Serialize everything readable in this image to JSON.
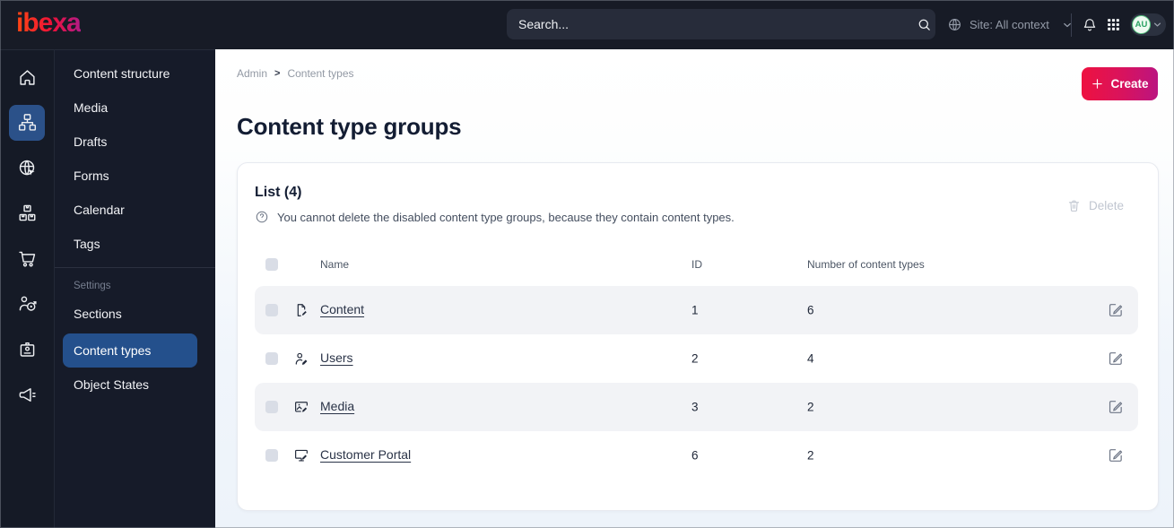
{
  "topbar": {
    "logo_text": "ibexa",
    "search_placeholder": "Search...",
    "site_context_label": "Site: All context",
    "avatar_initials": "AU",
    "icons": [
      "search-icon",
      "globe-icon",
      "chevron-down-icon",
      "bell-icon",
      "app-grid-icon"
    ]
  },
  "rail": {
    "icons": [
      "home-icon",
      "content-structure-icon",
      "site-search-icon",
      "product-catalog-icon",
      "commerce-cart-icon",
      "personalization-icon",
      "admin-badge-icon",
      "campaign-megaphone-icon"
    ],
    "active_index": 1
  },
  "sidebar": {
    "items": [
      "Content structure",
      "Media",
      "Drafts",
      "Forms",
      "Calendar",
      "Tags"
    ],
    "settings_label": "Settings",
    "settings_items": [
      "Sections",
      "Content types",
      "Object States"
    ],
    "active_item": "Content types"
  },
  "main": {
    "breadcrumb": [
      "Admin",
      "Content types"
    ],
    "breadcrumb_separator": ">",
    "create_label": "Create",
    "title": "Content type groups",
    "card": {
      "list_title": "List (4)",
      "info_text": "You cannot delete the disabled content type groups, because they contain content types.",
      "delete_label": "Delete",
      "table": {
        "headers": {
          "name": "Name",
          "id": "ID",
          "count": "Number of content types"
        },
        "rows": [
          {
            "name": "Content",
            "id": "1",
            "count": "6",
            "icon": "file-edit-icon"
          },
          {
            "name": "Users",
            "id": "2",
            "count": "4",
            "icon": "user-edit-icon"
          },
          {
            "name": "Media",
            "id": "3",
            "count": "2",
            "icon": "image-edit-icon"
          },
          {
            "name": "Customer Portal",
            "id": "6",
            "count": "2",
            "icon": "monitor-edit-icon"
          }
        ]
      }
    }
  },
  "colors": {
    "topbar_bg": "#171b26",
    "sidebar_bg": "#161b29",
    "active_blue": "#24508c",
    "accent_gradient_start": "#f01340",
    "accent_gradient_end": "#bb1480",
    "logo_gradient": [
      "#ff4713",
      "#ed1139",
      "#b31b87"
    ],
    "stripe_bg": "#f2f3f6",
    "avatar_green": "#55c27f"
  }
}
